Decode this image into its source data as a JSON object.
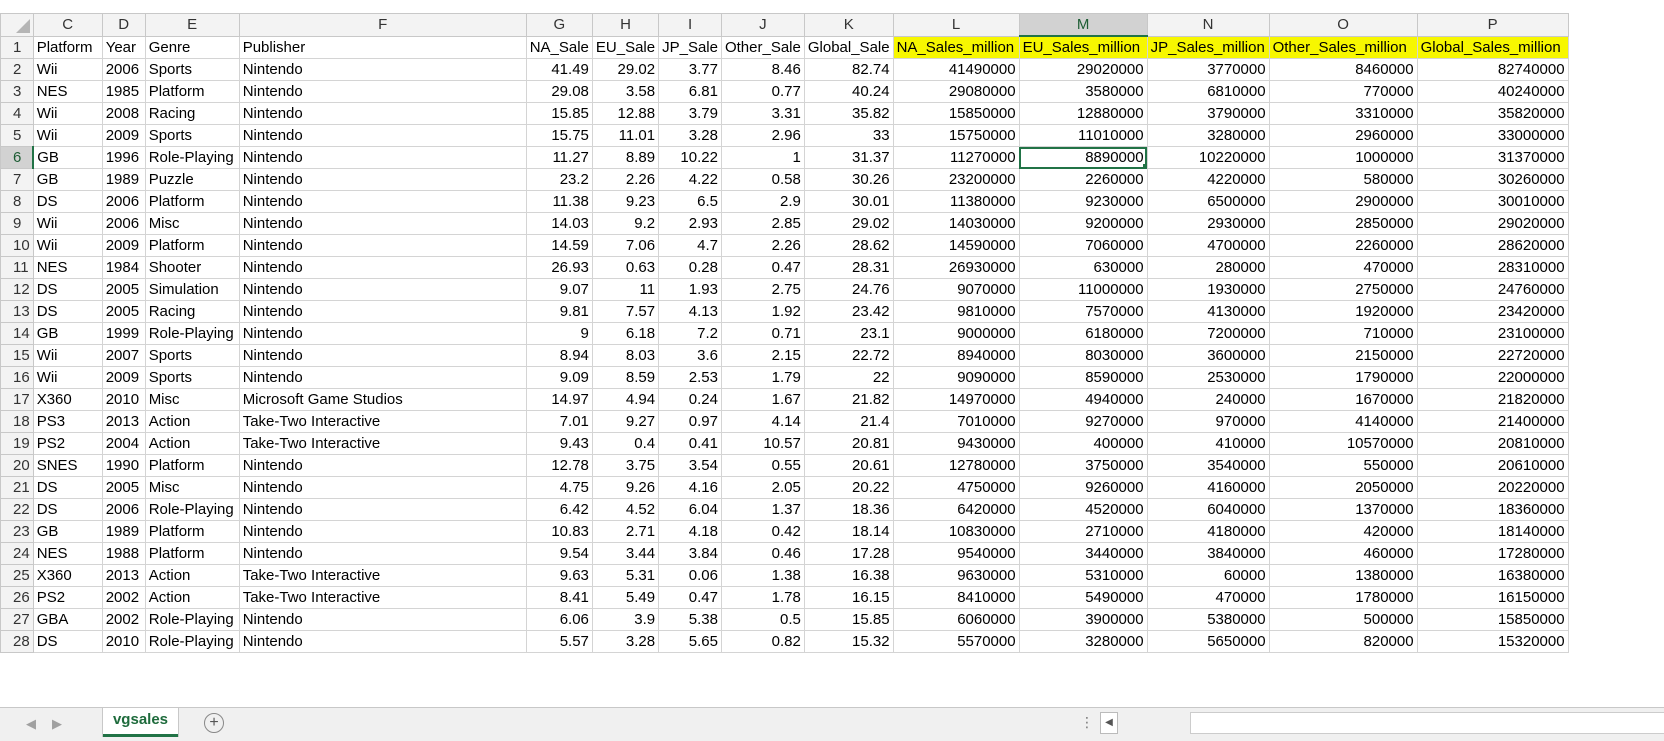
{
  "columns": [
    "C",
    "D",
    "E",
    "F",
    "G",
    "H",
    "I",
    "J",
    "K",
    "L",
    "M",
    "N",
    "O",
    "P"
  ],
  "headers": [
    "Platform",
    "Year",
    "Genre",
    "Publisher",
    "NA_Sale",
    "EU_Sale",
    "JP_Sale",
    "Other_Sale",
    "Global_Sale",
    "NA_Sales_million",
    "EU_Sales_million",
    "JP_Sales_million",
    "Other_Sales_million",
    "Global_Sales_million"
  ],
  "rows": [
    [
      "Wii",
      "2006",
      "Sports",
      "Nintendo",
      "41.49",
      "29.02",
      "3.77",
      "8.46",
      "82.74",
      "41490000",
      "29020000",
      "3770000",
      "8460000",
      "82740000"
    ],
    [
      "NES",
      "1985",
      "Platform",
      "Nintendo",
      "29.08",
      "3.58",
      "6.81",
      "0.77",
      "40.24",
      "29080000",
      "3580000",
      "6810000",
      "770000",
      "40240000"
    ],
    [
      "Wii",
      "2008",
      "Racing",
      "Nintendo",
      "15.85",
      "12.88",
      "3.79",
      "3.31",
      "35.82",
      "15850000",
      "12880000",
      "3790000",
      "3310000",
      "35820000"
    ],
    [
      "Wii",
      "2009",
      "Sports",
      "Nintendo",
      "15.75",
      "11.01",
      "3.28",
      "2.96",
      "33",
      "15750000",
      "11010000",
      "3280000",
      "2960000",
      "33000000"
    ],
    [
      "GB",
      "1996",
      "Role-Playing",
      "Nintendo",
      "11.27",
      "8.89",
      "10.22",
      "1",
      "31.37",
      "11270000",
      "8890000",
      "10220000",
      "1000000",
      "31370000"
    ],
    [
      "GB",
      "1989",
      "Puzzle",
      "Nintendo",
      "23.2",
      "2.26",
      "4.22",
      "0.58",
      "30.26",
      "23200000",
      "2260000",
      "4220000",
      "580000",
      "30260000"
    ],
    [
      "DS",
      "2006",
      "Platform",
      "Nintendo",
      "11.38",
      "9.23",
      "6.5",
      "2.9",
      "30.01",
      "11380000",
      "9230000",
      "6500000",
      "2900000",
      "30010000"
    ],
    [
      "Wii",
      "2006",
      "Misc",
      "Nintendo",
      "14.03",
      "9.2",
      "2.93",
      "2.85",
      "29.02",
      "14030000",
      "9200000",
      "2930000",
      "2850000",
      "29020000"
    ],
    [
      "Wii",
      "2009",
      "Platform",
      "Nintendo",
      "14.59",
      "7.06",
      "4.7",
      "2.26",
      "28.62",
      "14590000",
      "7060000",
      "4700000",
      "2260000",
      "28620000"
    ],
    [
      "NES",
      "1984",
      "Shooter",
      "Nintendo",
      "26.93",
      "0.63",
      "0.28",
      "0.47",
      "28.31",
      "26930000",
      "630000",
      "280000",
      "470000",
      "28310000"
    ],
    [
      "DS",
      "2005",
      "Simulation",
      "Nintendo",
      "9.07",
      "11",
      "1.93",
      "2.75",
      "24.76",
      "9070000",
      "11000000",
      "1930000",
      "2750000",
      "24760000"
    ],
    [
      "DS",
      "2005",
      "Racing",
      "Nintendo",
      "9.81",
      "7.57",
      "4.13",
      "1.92",
      "23.42",
      "9810000",
      "7570000",
      "4130000",
      "1920000",
      "23420000"
    ],
    [
      "GB",
      "1999",
      "Role-Playing",
      "Nintendo",
      "9",
      "6.18",
      "7.2",
      "0.71",
      "23.1",
      "9000000",
      "6180000",
      "7200000",
      "710000",
      "23100000"
    ],
    [
      "Wii",
      "2007",
      "Sports",
      "Nintendo",
      "8.94",
      "8.03",
      "3.6",
      "2.15",
      "22.72",
      "8940000",
      "8030000",
      "3600000",
      "2150000",
      "22720000"
    ],
    [
      "Wii",
      "2009",
      "Sports",
      "Nintendo",
      "9.09",
      "8.59",
      "2.53",
      "1.79",
      "22",
      "9090000",
      "8590000",
      "2530000",
      "1790000",
      "22000000"
    ],
    [
      "X360",
      "2010",
      "Misc",
      "Microsoft Game Studios",
      "14.97",
      "4.94",
      "0.24",
      "1.67",
      "21.82",
      "14970000",
      "4940000",
      "240000",
      "1670000",
      "21820000"
    ],
    [
      "PS3",
      "2013",
      "Action",
      "Take-Two Interactive",
      "7.01",
      "9.27",
      "0.97",
      "4.14",
      "21.4",
      "7010000",
      "9270000",
      "970000",
      "4140000",
      "21400000"
    ],
    [
      "PS2",
      "2004",
      "Action",
      "Take-Two Interactive",
      "9.43",
      "0.4",
      "0.41",
      "10.57",
      "20.81",
      "9430000",
      "400000",
      "410000",
      "10570000",
      "20810000"
    ],
    [
      "SNES",
      "1990",
      "Platform",
      "Nintendo",
      "12.78",
      "3.75",
      "3.54",
      "0.55",
      "20.61",
      "12780000",
      "3750000",
      "3540000",
      "550000",
      "20610000"
    ],
    [
      "DS",
      "2005",
      "Misc",
      "Nintendo",
      "4.75",
      "9.26",
      "4.16",
      "2.05",
      "20.22",
      "4750000",
      "9260000",
      "4160000",
      "2050000",
      "20220000"
    ],
    [
      "DS",
      "2006",
      "Role-Playing",
      "Nintendo",
      "6.42",
      "4.52",
      "6.04",
      "1.37",
      "18.36",
      "6420000",
      "4520000",
      "6040000",
      "1370000",
      "18360000"
    ],
    [
      "GB",
      "1989",
      "Platform",
      "Nintendo",
      "10.83",
      "2.71",
      "4.18",
      "0.42",
      "18.14",
      "10830000",
      "2710000",
      "4180000",
      "420000",
      "18140000"
    ],
    [
      "NES",
      "1988",
      "Platform",
      "Nintendo",
      "9.54",
      "3.44",
      "3.84",
      "0.46",
      "17.28",
      "9540000",
      "3440000",
      "3840000",
      "460000",
      "17280000"
    ],
    [
      "X360",
      "2013",
      "Action",
      "Take-Two Interactive",
      "9.63",
      "5.31",
      "0.06",
      "1.38",
      "16.38",
      "9630000",
      "5310000",
      "60000",
      "1380000",
      "16380000"
    ],
    [
      "PS2",
      "2002",
      "Action",
      "Take-Two Interactive",
      "8.41",
      "5.49",
      "0.47",
      "1.78",
      "16.15",
      "8410000",
      "5490000",
      "470000",
      "1780000",
      "16150000"
    ],
    [
      "GBA",
      "2002",
      "Role-Playing",
      "Nintendo",
      "6.06",
      "3.9",
      "5.38",
      "0.5",
      "15.85",
      "6060000",
      "3900000",
      "5380000",
      "500000",
      "15850000"
    ],
    [
      "DS",
      "2010",
      "Role-Playing",
      "Nintendo",
      "5.57",
      "3.28",
      "5.65",
      "0.82",
      "15.32",
      "5570000",
      "3280000",
      "5650000",
      "820000",
      "15320000"
    ]
  ],
  "active_cell": {
    "column": "M",
    "row": "6"
  },
  "sheet_tab": "vgsales",
  "add_sheet_symbol": "+",
  "scroll_dots": "⋮",
  "nav_prev": "◀",
  "nav_next": "▶",
  "scroll_left": "◀",
  "colors": {
    "highlight": "#f7f700",
    "accent": "#217346"
  }
}
